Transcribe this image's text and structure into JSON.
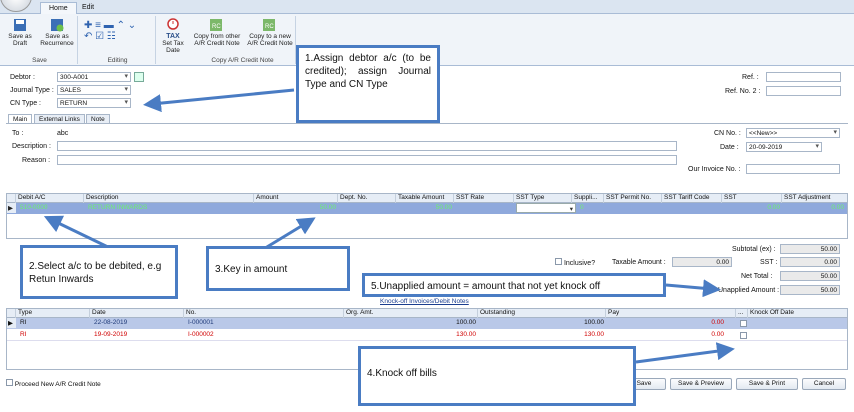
{
  "ribbon": {
    "tabs": [
      "Home",
      "Edit"
    ],
    "groups": {
      "save": "Save",
      "editing": "Editing",
      "copy": "Copy A/R Credit Note"
    },
    "buttons": {
      "save_draft": "Save as Draft",
      "save_recurrence": "Save as Recurrence",
      "set_tax_date": "Set Tax Date",
      "copy_from_other": "Copy from other A/R Credit Note",
      "copy_to_new": "Copy to a new A/R Credit Note"
    },
    "tax_badge": "TAX"
  },
  "header": {
    "debtor_label": "Debtor :",
    "debtor_value": "300-A001",
    "journal_type_label": "Journal Type :",
    "journal_type_value": "SALES",
    "cn_type_label": "CN Type :",
    "cn_type_value": "RETURN",
    "ref_label": "Ref. :",
    "ref2_label": "Ref. No. 2 :"
  },
  "tabs": [
    "Main",
    "External Links",
    "Note"
  ],
  "main": {
    "to_label": "To :",
    "to_value": "abc",
    "description_label": "Description :",
    "reason_label": "Reason :",
    "cn_no_label": "CN No. :",
    "cn_no_value": "<<New>>",
    "date_label": "Date :",
    "date_value": "20-09-2019",
    "invoice_no_label": "Our Invoice No. :"
  },
  "detail_grid": {
    "columns": [
      "Debit A/C",
      "Description",
      "Amount",
      "Dept. No.",
      "Taxable Amount",
      "SST Rate",
      "SST Type",
      "Suppli...",
      "SST Permit No.",
      "SST Tariff Code",
      "SST",
      "SST Adjustment"
    ],
    "row": {
      "debit_ac": "510-0000",
      "description": "RETURN INWARDS",
      "amount": "50.00",
      "taxable": "50.00",
      "suppli": "0",
      "sst": "0.00",
      "sst_adj": "0.00"
    }
  },
  "totals": {
    "subtotal_label": "Subtotal (ex) :",
    "subtotal_value": "50.00",
    "inclusive_label": "Inclusive?",
    "taxable_label": "Taxable Amount :",
    "taxable_value": "0.00",
    "sst_label": "SST :",
    "sst_value": "0.00",
    "net_label": "Net Total :",
    "net_value": "50.00",
    "unapplied_label": "Unapplied Amount :",
    "unapplied_value": "50.00"
  },
  "knockoff": {
    "link": "Knock-off Invoices/Debit Notes",
    "columns": [
      "Type",
      "Date",
      "No.",
      "Org. Amt.",
      "Outstanding",
      "Pay",
      "...",
      "Knock Off Date"
    ],
    "rows": [
      {
        "type": "RI",
        "date": "22-08-2019",
        "no": "I-000001",
        "org": "100.00",
        "outstanding": "100.00",
        "pay": "0.00"
      },
      {
        "type": "RI",
        "date": "19-09-2019",
        "no": "I-000002",
        "org": "130.00",
        "outstanding": "130.00",
        "pay": "0.00"
      }
    ]
  },
  "footer": {
    "proceed_label": "Proceed New A/R Credit Note",
    "save": "Save",
    "save_preview": "Save & Preview",
    "save_print": "Save & Print",
    "cancel": "Cancel"
  },
  "callouts": {
    "c1": "1.Assign debtor a/c (to be credited); assign Journal Type and CN Type",
    "c2": "2.Select a/c to be debited, e.g Retun Inwards",
    "c3": "3.Key in amount",
    "c4": "4.Knock off bills",
    "c5": "5.Unapplied amount = amount that not yet knock off"
  },
  "colors": {
    "accent": "#4a7cc3",
    "selected_row": "#8fa9dc",
    "red_text": "#d00000"
  }
}
